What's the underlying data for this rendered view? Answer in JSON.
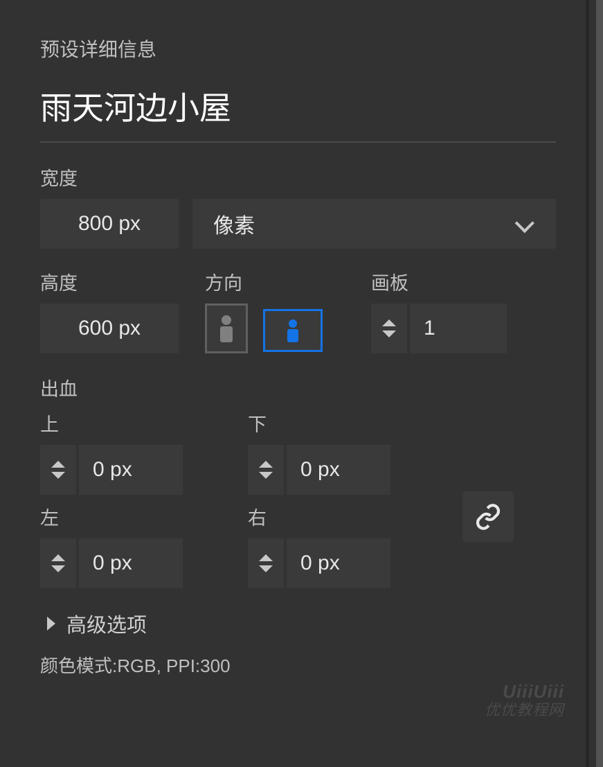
{
  "header": {
    "section_label": "预设详细信息",
    "title": "雨天河边小屋"
  },
  "width": {
    "label": "宽度",
    "value": "800 px",
    "unit_selected": "像素"
  },
  "height": {
    "label": "高度",
    "value": "600 px"
  },
  "orientation": {
    "label": "方向",
    "selected": "landscape"
  },
  "artboards": {
    "label": "画板",
    "value": "1"
  },
  "bleed": {
    "label": "出血",
    "top_label": "上",
    "bottom_label": "下",
    "left_label": "左",
    "right_label": "右",
    "top": "0 px",
    "bottom": "0 px",
    "left": "0 px",
    "right": "0 px"
  },
  "advanced": {
    "label": "高级选项",
    "summary": "颜色模式:RGB, PPI:300"
  },
  "watermark": {
    "line1": "UiiiUiii",
    "line2": "优优教程网"
  }
}
